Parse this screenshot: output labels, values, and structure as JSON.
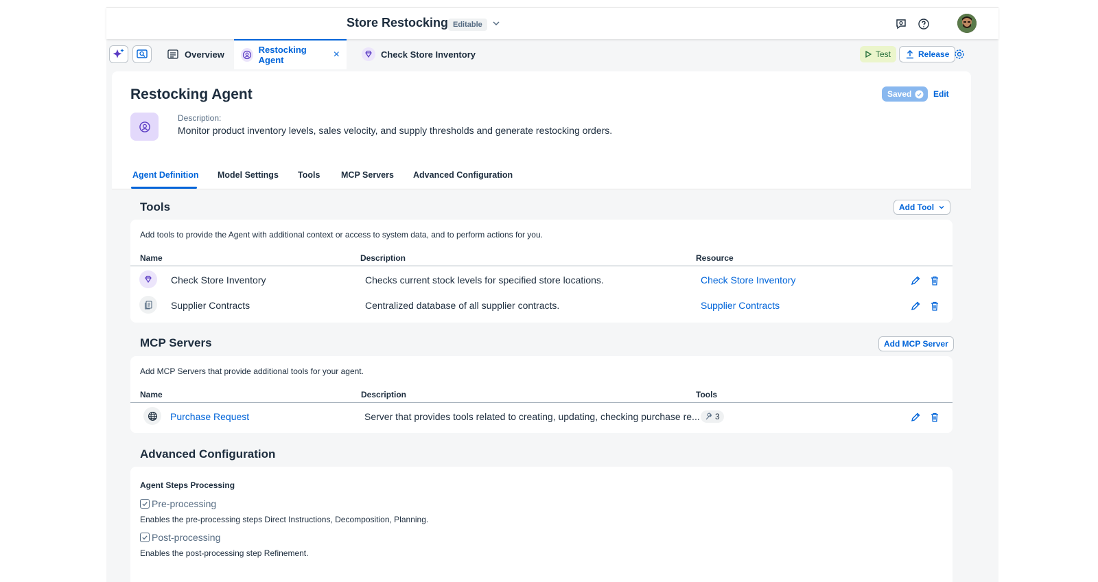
{
  "shell": {
    "title": "Store Restocking",
    "badge": "Editable"
  },
  "tabs": {
    "overview": "Overview",
    "restocking_agent": "Restocking Agent",
    "check_store_inventory": "Check Store Inventory",
    "test": "Test",
    "release": "Release"
  },
  "header": {
    "title": "Restocking Agent",
    "saved": "Saved",
    "edit": "Edit",
    "description_label": "Description:",
    "description": "Monitor product inventory levels, sales velocity, and supply thresholds and generate restocking orders."
  },
  "section_tabs": [
    "Agent Definition",
    "Model Settings",
    "Tools",
    "MCP Servers",
    "Advanced Configuration"
  ],
  "tools": {
    "heading": "Tools",
    "add_button": "Add Tool",
    "intro": "Add tools to provide the Agent with additional context or access to system data, and to perform actions for you.",
    "columns": [
      "Name",
      "Description",
      "Resource"
    ],
    "rows": [
      {
        "name": "Check Store Inventory",
        "description": "Checks current stock levels for specified store locations.",
        "resource": "Check Store Inventory",
        "icon": "diamond-icon"
      },
      {
        "name": "Supplier Contracts",
        "description": "Centralized database of all supplier contracts.",
        "resource": "Supplier Contracts",
        "icon": "document-stack-icon"
      }
    ]
  },
  "mcp": {
    "heading": "MCP Servers",
    "add_button": "Add MCP Server",
    "intro": "Add MCP Servers that provide additional tools for your agent.",
    "columns": [
      "Name",
      "Description",
      "Tools"
    ],
    "rows": [
      {
        "name": "Purchase Request",
        "description": "Server that provides tools related to creating, updating, checking purchase re...",
        "tools": "3",
        "icon": "globe-icon"
      }
    ]
  },
  "advanced": {
    "heading": "Advanced Configuration",
    "subheading": "Agent Steps Processing",
    "options": [
      {
        "label": "Pre-processing",
        "help": "Enables the pre-processing steps Direct Instructions, Decomposition, Planning.",
        "checked": true
      },
      {
        "label": "Post-processing",
        "help": "Enables the post-processing step Refinement.",
        "checked": true
      }
    ]
  },
  "colors": {
    "accent": "#0064d9",
    "agent_purple": "#e3d9fb",
    "saved": "#89b8ef"
  }
}
